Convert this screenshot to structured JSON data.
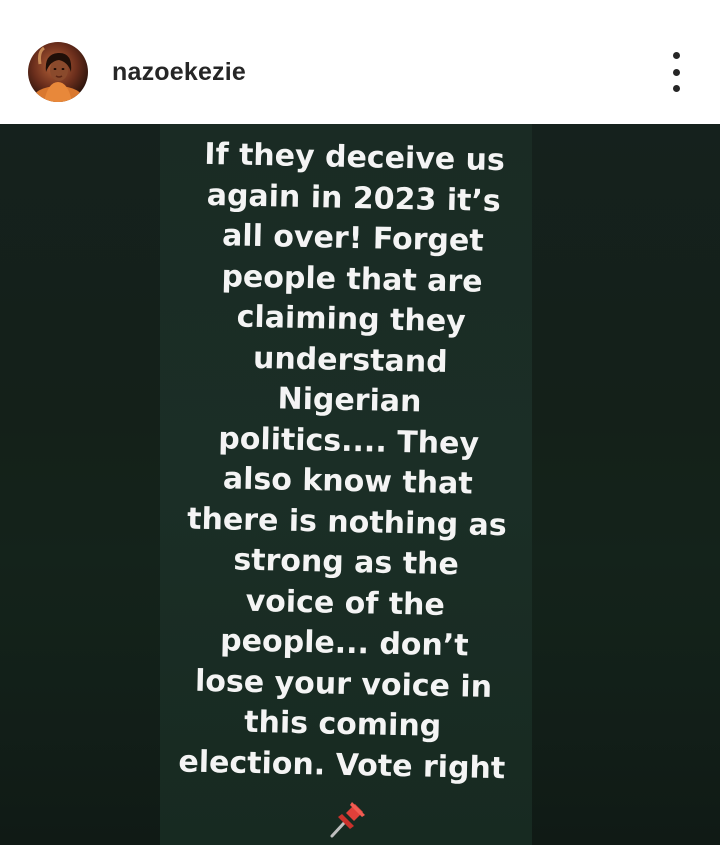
{
  "header": {
    "username": "nazoekezie",
    "avatar_icon": "profile-avatar",
    "more_icon": "more-vertical-icon"
  },
  "post": {
    "background": "#172821",
    "text_color": "#f4f4f4",
    "text": "If they deceive us\nagain in 2023 it’s\nall over! Forget\npeople that are\nclaiming they\nunderstand\nNigerian\npolitics.... They\nalso know that\nthere is nothing as\nstrong as the\nvoice of the\npeople... don’t\nlose your voice in\nthis coming\nelection. Vote right",
    "emoji_icon": "pushpin-icon",
    "emoji_color": "#e0403a"
  }
}
